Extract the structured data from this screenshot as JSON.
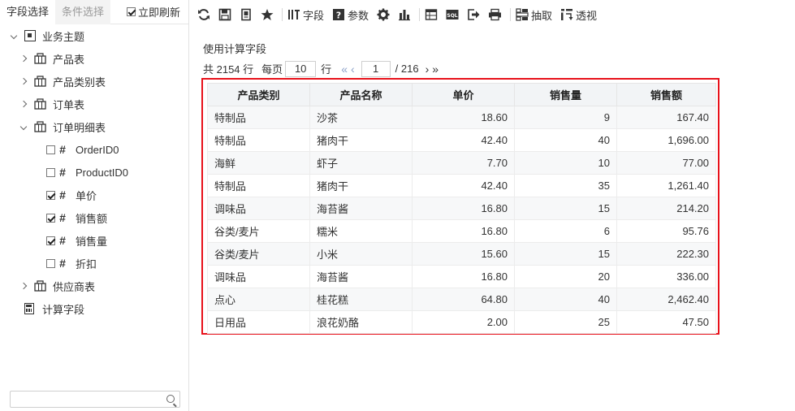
{
  "left_panel": {
    "tab_fields": "字段选择",
    "tab_conditions": "条件选择",
    "refresh_label": "立即刷新",
    "tree": {
      "root": "业务主题",
      "tables": {
        "product": "产品表",
        "product_category": "产品类别表",
        "order": "订单表",
        "order_detail": "订单明细表",
        "supplier": "供应商表"
      },
      "fields": [
        {
          "label": "OrderID0",
          "checked": false
        },
        {
          "label": "ProductID0",
          "checked": false
        },
        {
          "label": "单价",
          "checked": true
        },
        {
          "label": "销售额",
          "checked": true
        },
        {
          "label": "销售量",
          "checked": true
        },
        {
          "label": "折扣",
          "checked": false
        }
      ],
      "calc_field": "计算字段"
    },
    "search": {
      "value": "",
      "placeholder": ""
    }
  },
  "toolbar": {
    "field_label": "字段",
    "param_label": "参数",
    "extract_label": "抽取",
    "pivot_label": "透视",
    "sql_label": "SQL"
  },
  "content": {
    "caption": "使用计算字段",
    "pager": {
      "total_prefix": "共 2154 行",
      "per_page_label": "每页",
      "per_page_value": "10",
      "rows_unit": "行",
      "current_page": "1",
      "total_pages": "/ 216"
    },
    "table": {
      "headers": [
        "产品类别",
        "产品名称",
        "单价",
        "销售量",
        "销售额"
      ],
      "rows": [
        [
          "特制品",
          "沙茶",
          "18.60",
          "9",
          "167.40"
        ],
        [
          "特制品",
          "猪肉干",
          "42.40",
          "40",
          "1,696.00"
        ],
        [
          "海鲜",
          "虾子",
          "7.70",
          "10",
          "77.00"
        ],
        [
          "特制品",
          "猪肉干",
          "42.40",
          "35",
          "1,261.40"
        ],
        [
          "调味品",
          "海苔酱",
          "16.80",
          "15",
          "214.20"
        ],
        [
          "谷类/麦片",
          "糯米",
          "16.80",
          "6",
          "95.76"
        ],
        [
          "谷类/麦片",
          "小米",
          "15.60",
          "15",
          "222.30"
        ],
        [
          "调味品",
          "海苔酱",
          "16.80",
          "20",
          "336.00"
        ],
        [
          "点心",
          "桂花糕",
          "64.80",
          "40",
          "2,462.40"
        ],
        [
          "日用品",
          "浪花奶酪",
          "2.00",
          "25",
          "47.50"
        ]
      ]
    }
  },
  "colors": {
    "highlight_border": "#e8111a",
    "header_bg": "#f2f4f6",
    "pager_nav": "#8aa0c8"
  }
}
